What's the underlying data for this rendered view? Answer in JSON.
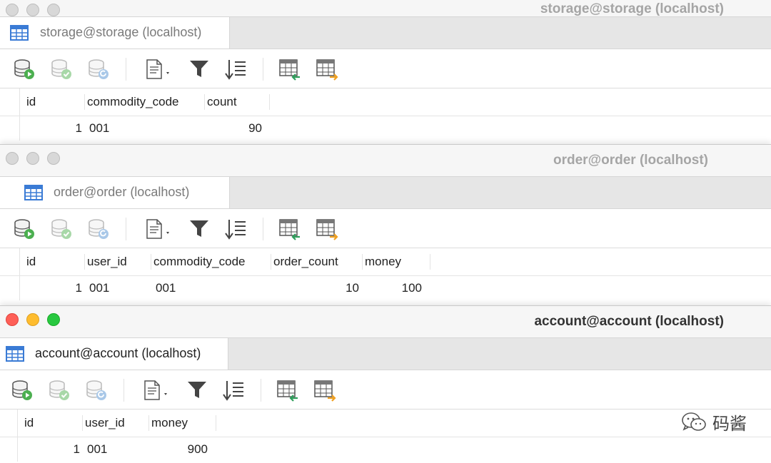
{
  "windows": [
    {
      "title": "storage@storage (localhost)",
      "tab_label": "storage@storage (localhost)",
      "columns": [
        "id",
        "commodity_code",
        "count"
      ],
      "rows": [
        [
          "1",
          "001",
          "90"
        ]
      ]
    },
    {
      "title": "order@order (localhost)",
      "tab_label": "order@order (localhost)",
      "columns": [
        "id",
        "user_id",
        "commodity_code",
        "order_count",
        "money"
      ],
      "rows": [
        [
          "1",
          "001",
          "001",
          "10",
          "100"
        ]
      ]
    },
    {
      "title": "account@account (localhost)",
      "tab_label": "account@account (localhost)",
      "columns": [
        "id",
        "user_id",
        "money"
      ],
      "rows": [
        [
          "1",
          "001",
          "900"
        ]
      ]
    }
  ],
  "toolbar_icons": [
    "database-run-icon",
    "database-commit-icon",
    "database-refresh-icon",
    "export-document-icon",
    "filter-icon",
    "sort-icon",
    "import-table-icon",
    "export-table-icon"
  ],
  "watermark": {
    "text": "码酱",
    "icon": "wechat-icon"
  },
  "colors": {
    "accent_blue": "#3a7bd5",
    "run_green": "#4caf50",
    "traffic_red": "#fe5f57",
    "traffic_yellow": "#febc2e",
    "traffic_green": "#28c840"
  }
}
